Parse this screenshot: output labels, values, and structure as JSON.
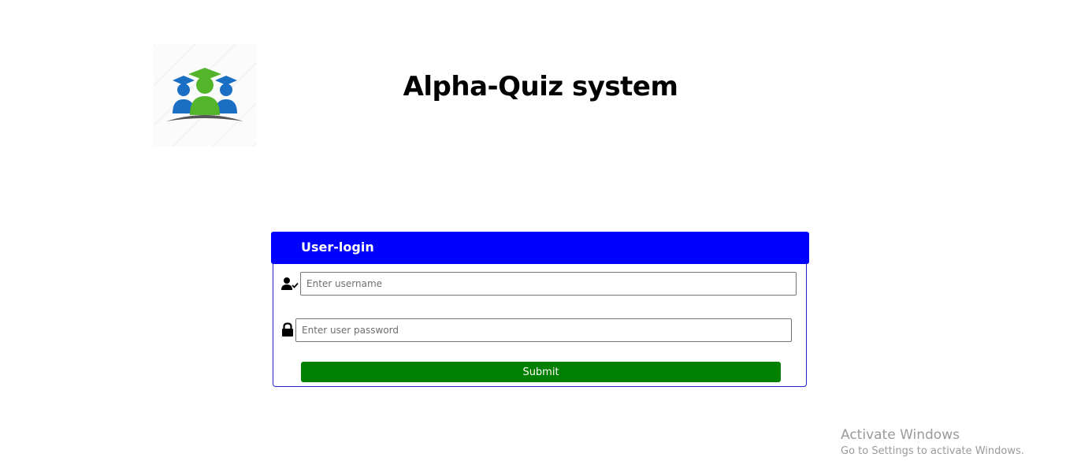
{
  "header": {
    "title": "Alpha-Quiz system"
  },
  "logo": {
    "icon": "graduates-logo"
  },
  "login": {
    "heading": "User-login",
    "username_placeholder": "Enter username",
    "password_placeholder": "Enter user password",
    "submit_label": "Submit",
    "username_icon": "user-check-icon",
    "password_icon": "lock-icon"
  },
  "colors": {
    "header_bg": "#0000ff",
    "submit_bg": "#008000",
    "card_border": "#2222cc"
  },
  "watermark": {
    "title": "Activate Windows",
    "subtitle": "Go to Settings to activate Windows."
  }
}
